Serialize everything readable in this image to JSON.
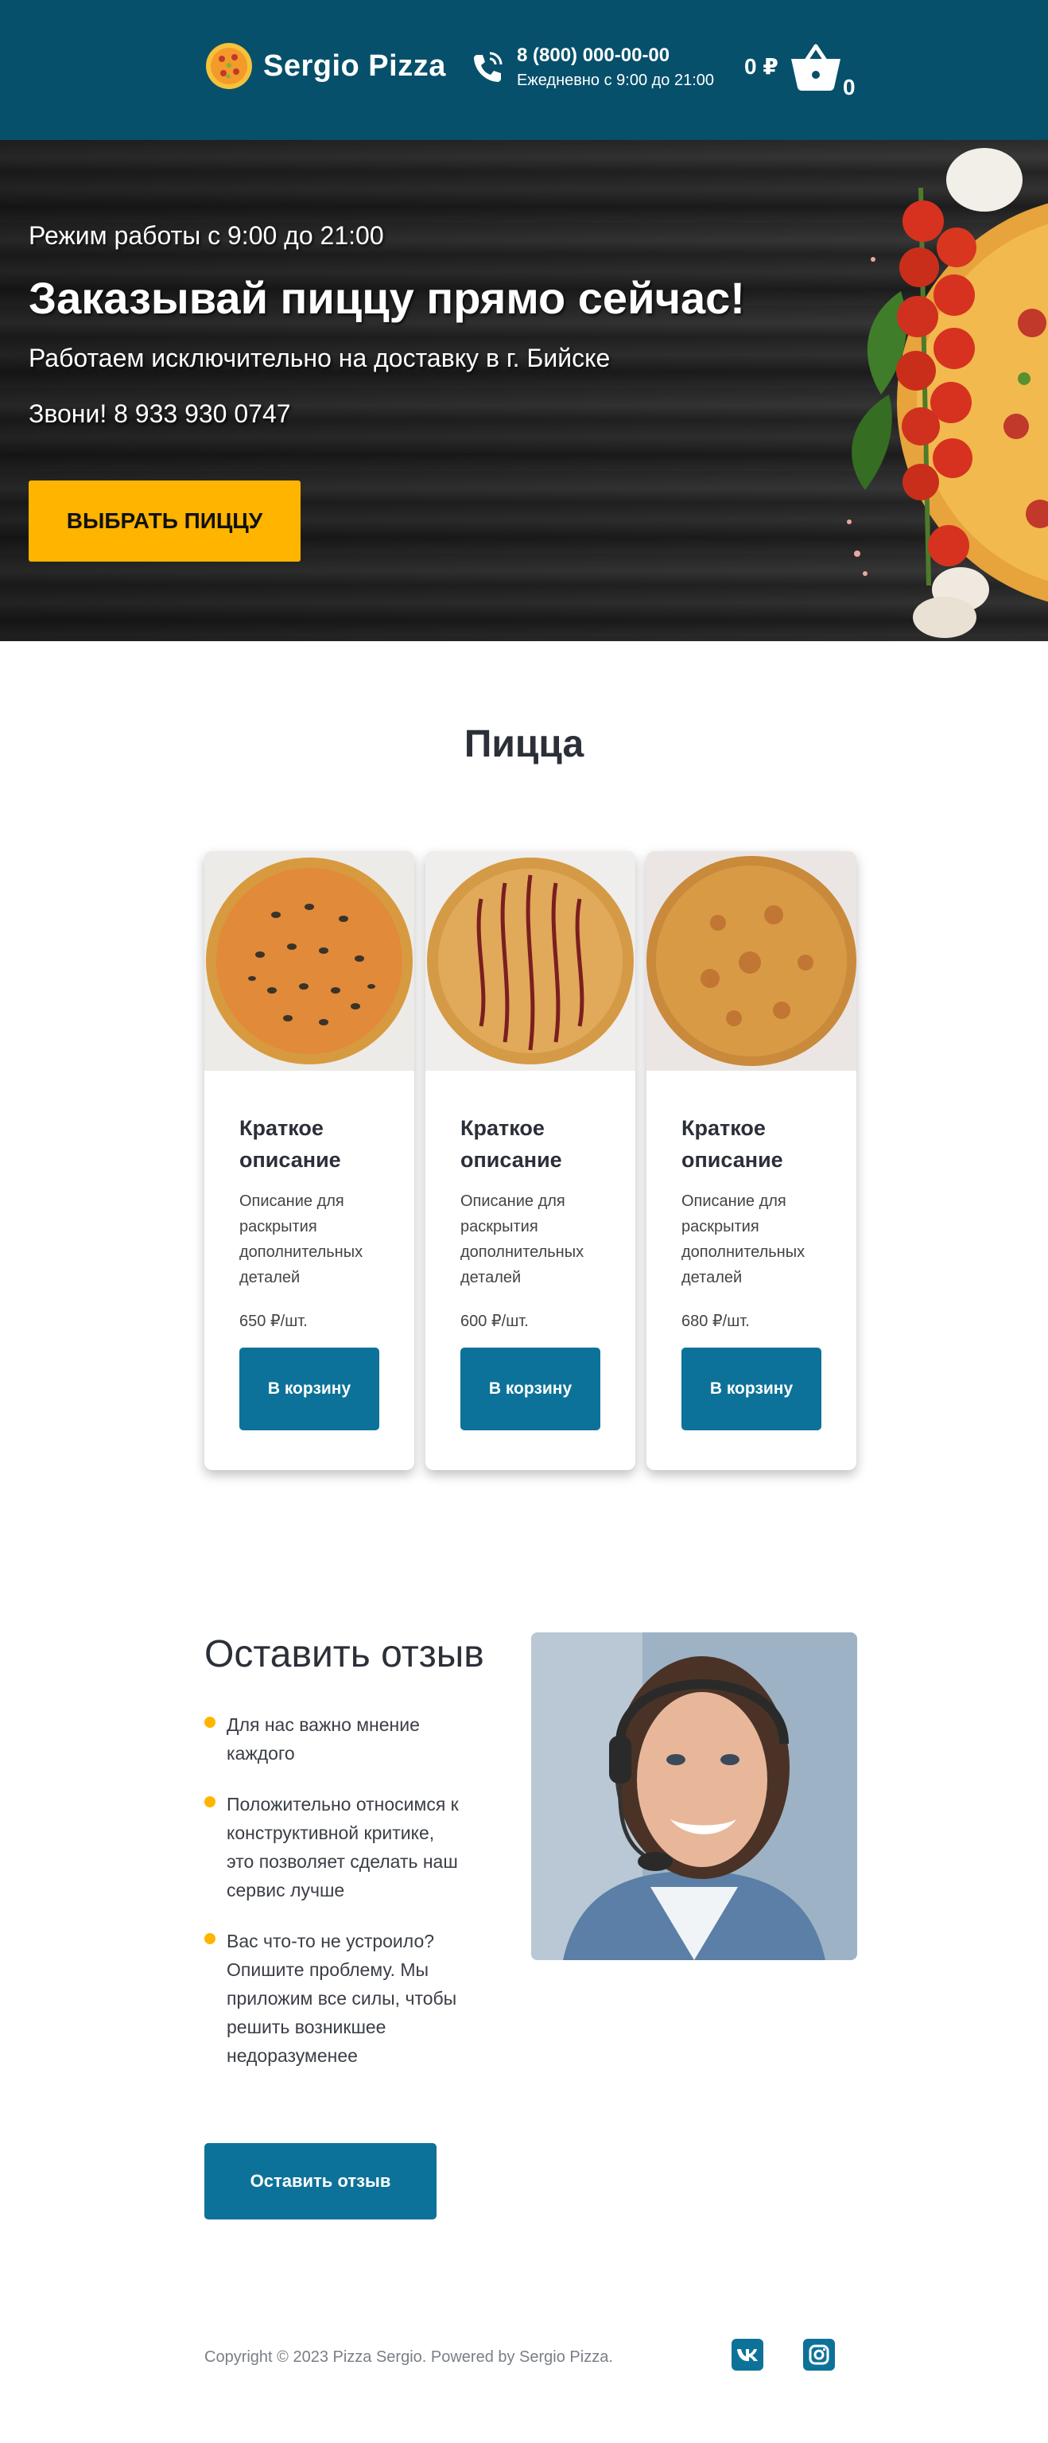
{
  "header": {
    "logo_text": "Sergio Pizza",
    "phone_number": "8 (800) 000-00-00",
    "phone_hours": "Ежедневно с 9:00 до 21:00",
    "cart_sum": "0 ₽",
    "cart_count": "0"
  },
  "hero": {
    "hours": "Режим работы с 9:00 до 21:00",
    "title": "Заказывай пиццу прямо сейчас!",
    "subtitle": "Работаем исключительно на доставку в г. Бийске",
    "call": "Звони! 8 933 930 0747",
    "button": "ВЫБРАТЬ ПИЦЦУ"
  },
  "pizza_section": {
    "title": "Пицца",
    "cards": [
      {
        "title": "Краткое описание",
        "description": "Описание для раскрытия дополнительных деталей",
        "price": "650 ₽/шт.",
        "button": "В корзину"
      },
      {
        "title": "Краткое описание",
        "description": "Описание для раскрытия дополнительных деталей",
        "price": "600 ₽/шт.",
        "button": "В корзину"
      },
      {
        "title": "Краткое описание",
        "description": "Описание для раскрытия дополнительных деталей",
        "price": "680 ₽/шт.",
        "button": "В корзину"
      }
    ]
  },
  "review": {
    "title": "Оставить отзыв",
    "bullets": [
      "Для нас важно мнение каждого",
      "Положительно относимся к конструктивной критике, это позволяет сделать наш сервис лучше",
      "Вас что-то не устроило? Опишите проблему. Мы приложим все силы, чтобы решить возникшее недоразуменее"
    ],
    "button": "Оставить отзыв"
  },
  "footer": {
    "copyright": "Copyright © 2023 Pizza Sergio. Powered by Sergio Pizza.",
    "social": [
      "vk-icon",
      "instagram-icon"
    ]
  },
  "colors": {
    "header_bg": "#06506b",
    "accent_yellow": "#ffb400",
    "button_blue": "#0d7299"
  }
}
